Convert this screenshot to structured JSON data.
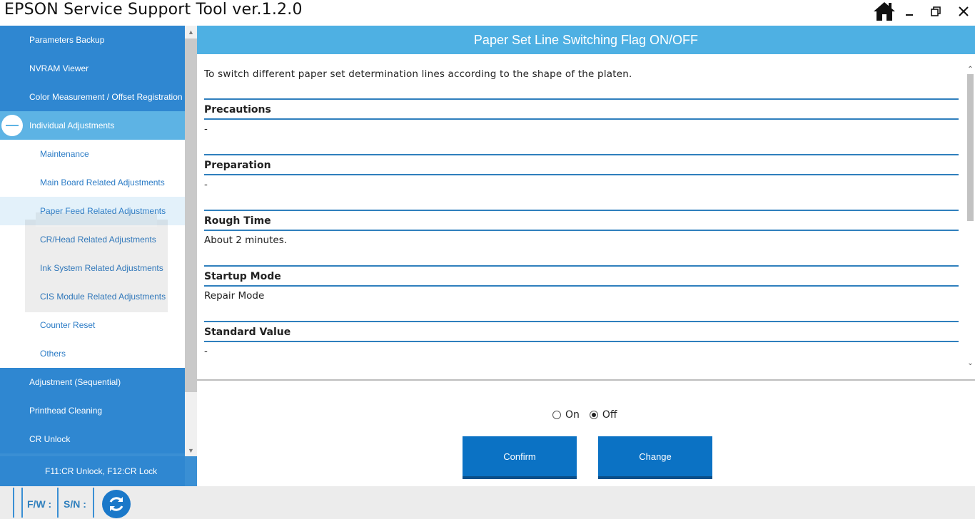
{
  "app": {
    "title": "EPSON Service Support Tool  ver.1.2.0"
  },
  "window_controls": {
    "home_icon": "home-icon",
    "minimize_icon": "minimize-icon",
    "maximize_icon": "restore-icon",
    "close_icon": "close-icon"
  },
  "sidebar": {
    "items": [
      {
        "label": "Parameters Backup",
        "level": 1
      },
      {
        "label": "NVRAM Viewer",
        "level": 1
      },
      {
        "label": "Color Measurement / Offset Registration",
        "level": 1
      },
      {
        "label": "Individual Adjustments",
        "level": 1,
        "expanded": true
      },
      {
        "label": "Maintenance",
        "level": 2
      },
      {
        "label": "Main Board Related Adjustments",
        "level": 2
      },
      {
        "label": "Paper Feed Related Adjustments",
        "level": 2,
        "highlighted": true
      },
      {
        "label": "CR/Head Related Adjustments",
        "level": 2
      },
      {
        "label": "Ink System Related Adjustments",
        "level": 2
      },
      {
        "label": "CIS Module Related Adjustments",
        "level": 2
      },
      {
        "label": "Counter Reset",
        "level": 2
      },
      {
        "label": "Others",
        "level": 2
      },
      {
        "label": "Adjustment (Sequential)",
        "level": 1
      },
      {
        "label": "Printhead Cleaning",
        "level": 1
      },
      {
        "label": "CR Unlock",
        "level": 1
      }
    ],
    "shortcut_hint": "F11:CR Unlock, F12:CR Lock"
  },
  "main": {
    "header": "Paper Set Line Switching Flag ON/OFF",
    "description": "To switch different paper set determination lines according to the shape of the platen.",
    "sections": [
      {
        "title": "Precautions",
        "value": "-"
      },
      {
        "title": "Preparation",
        "value": "-"
      },
      {
        "title": "Rough Time",
        "value": "About 2 minutes."
      },
      {
        "title": "Startup Mode",
        "value": "Repair Mode"
      },
      {
        "title": "Standard Value",
        "value": "-"
      }
    ],
    "options": [
      {
        "label": "On",
        "checked": false
      },
      {
        "label": "Off",
        "checked": true
      }
    ],
    "confirm_label": "Confirm",
    "change_label": "Change"
  },
  "statusbar": {
    "fw_label": "F/W :",
    "sn_label": "S/N :",
    "refresh_icon": "refresh-icon"
  },
  "colors": {
    "sidebar_blue": "#2f87d1",
    "header_blue": "#4eb0e3",
    "active_item": "#5db3e4",
    "button_blue": "#0b72c4"
  }
}
